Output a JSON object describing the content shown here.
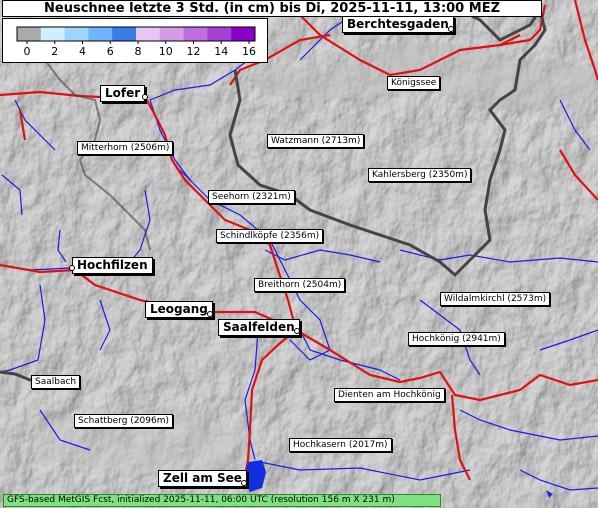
{
  "title": "Neuschnee letzte 3 Std. (in cm) bis Di, 2025-11-11, 13:00 MEZ",
  "legend": {
    "ticks": [
      "0",
      "2",
      "4",
      "6",
      "8",
      "10",
      "12",
      "14",
      "16"
    ],
    "colors": [
      "#aaaaaa",
      "#cfefff",
      "#9fd4ff",
      "#6fb4ff",
      "#3a7de6",
      "#e6c6f2",
      "#d39be8",
      "#bf6fe0",
      "#a63fd6",
      "#8a00c8"
    ]
  },
  "places": [
    {
      "name": "Berchtesgaden",
      "type": "city"
    },
    {
      "name": "Königssee",
      "type": "small"
    },
    {
      "name": "Lofer",
      "type": "city"
    },
    {
      "name": "Watzmann (2713m)",
      "type": "small"
    },
    {
      "name": "Mitterhorn (2506m)",
      "type": "small"
    },
    {
      "name": "Kahlersberg (2350m)",
      "type": "small"
    },
    {
      "name": "Seehorn (2321m)",
      "type": "small"
    },
    {
      "name": "Schindlköpfe (2356m)",
      "type": "small"
    },
    {
      "name": "Hochfilzen",
      "type": "city"
    },
    {
      "name": "Breithorn (2504m)",
      "type": "small"
    },
    {
      "name": "Wildalmkirchl (2573m)",
      "type": "small"
    },
    {
      "name": "Leogang",
      "type": "city"
    },
    {
      "name": "Saalfelden",
      "type": "city"
    },
    {
      "name": "Hochkönig (2941m)",
      "type": "small"
    },
    {
      "name": "Saalbach",
      "type": "small"
    },
    {
      "name": "Dienten am Hochkönig",
      "type": "small"
    },
    {
      "name": "Schattberg (2096m)",
      "type": "small"
    },
    {
      "name": "Hochkasern (2017m)",
      "type": "small"
    },
    {
      "name": "Zell am See",
      "type": "city"
    }
  ],
  "footer": "GFS-based MetGIS Fcst, initialized 2025-11-11, 06:00 UTC  (resolution 156 m X 231 m)",
  "colors": {
    "roads": "#e01010",
    "rivers": "#1a1aee",
    "border": "#444444",
    "lake": "#1030e0"
  }
}
